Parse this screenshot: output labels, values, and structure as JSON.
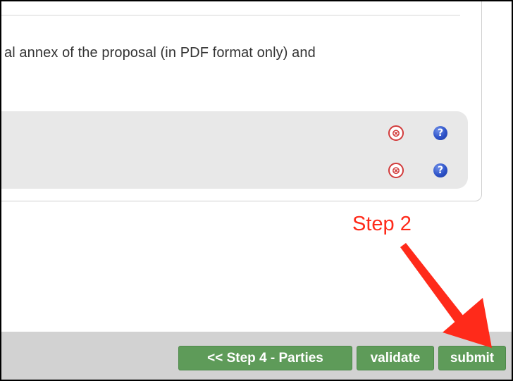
{
  "content": {
    "annex_text": "al annex of the proposal (in PDF format only) and"
  },
  "files": {
    "rows": [
      {
        "remove_icon": "⊗",
        "help_icon": "?"
      },
      {
        "remove_icon": "⊗",
        "help_icon": "?"
      }
    ]
  },
  "annotation": {
    "step_label": "Step 2",
    "color": "#ff2a1a"
  },
  "toolbar": {
    "back_label": "<< Step 4 - Parties",
    "validate_label": "validate",
    "submit_label": "submit",
    "button_color": "#5e9b59",
    "bar_color": "#d2d2d2"
  }
}
